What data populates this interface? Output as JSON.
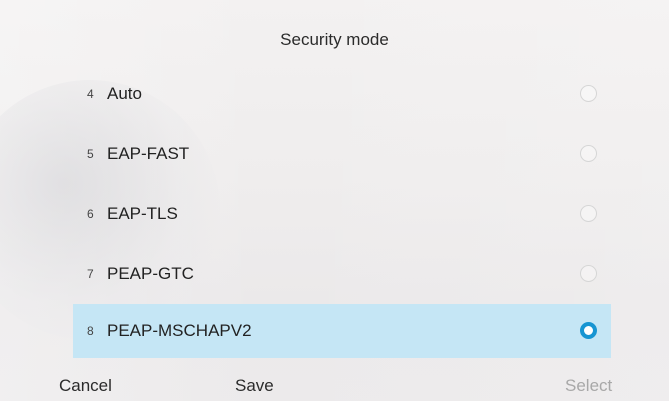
{
  "title": "Security mode",
  "options": [
    {
      "number": "4",
      "label": "Auto",
      "selected": false
    },
    {
      "number": "5",
      "label": "EAP-FAST",
      "selected": false
    },
    {
      "number": "6",
      "label": "EAP-TLS",
      "selected": false
    },
    {
      "number": "7",
      "label": "PEAP-GTC",
      "selected": false
    },
    {
      "number": "8",
      "label": "PEAP-MSCHAPV2",
      "selected": true
    }
  ],
  "softkeys": {
    "cancel": "Cancel",
    "save": "Save",
    "select": "Select"
  },
  "colors": {
    "selected_row": "#c5e6f5",
    "radio_accent": "#1795d2",
    "disabled_text": "#a8a8a8"
  }
}
